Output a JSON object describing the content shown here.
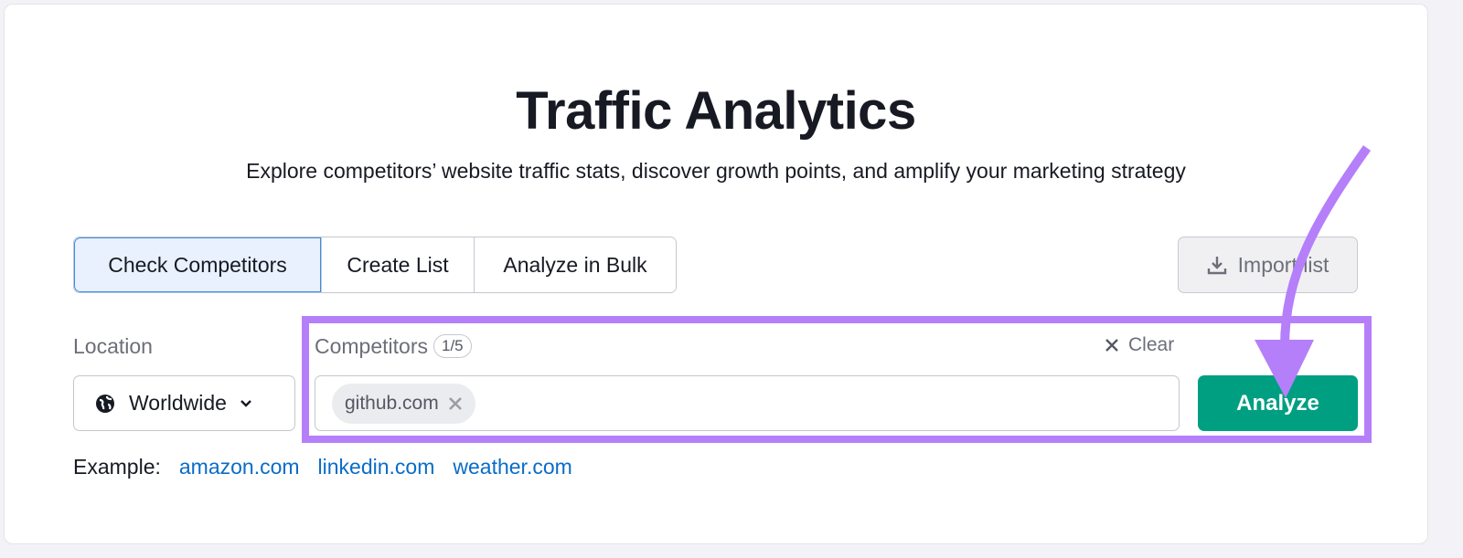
{
  "header": {
    "title": "Traffic Analytics",
    "subtitle": "Explore competitors’ website traffic stats, discover growth points, and amplify your marketing strategy"
  },
  "tabs": [
    {
      "label": "Check Competitors",
      "active": true
    },
    {
      "label": "Create List"
    },
    {
      "label": "Analyze in Bulk"
    }
  ],
  "import_button": {
    "label": "Import list",
    "icon": "download-icon"
  },
  "location": {
    "label": "Location",
    "value": "Worldwide",
    "icon": "globe-icon"
  },
  "competitors": {
    "label": "Competitors",
    "count": "1/5",
    "clear_label": "Clear",
    "chips": [
      "github.com"
    ]
  },
  "analyze_button": {
    "label": "Analyze"
  },
  "examples": {
    "label": "Example:",
    "links": [
      "amazon.com",
      "linkedin.com",
      "weather.com"
    ]
  },
  "colors": {
    "accent": "#009f81",
    "highlight": "#b57ffa",
    "link": "#0a6cc7"
  }
}
